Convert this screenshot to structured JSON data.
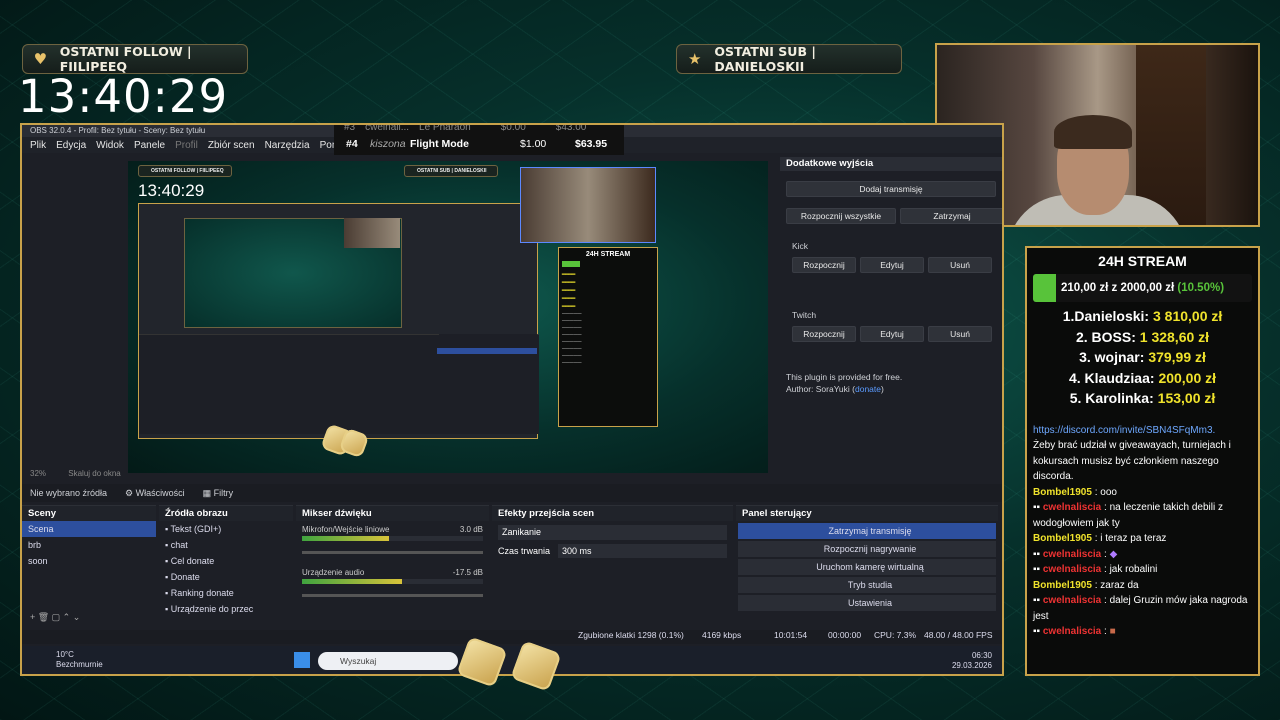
{
  "overlay": {
    "last_follow": "OSTATNI FOLLOW | FIILIPEEQ",
    "last_sub": "OSTATNI SUB | DANIELOSKII",
    "clock": "13:40:29"
  },
  "leaderboard_snippet": {
    "partial_row": {
      "rank": "#3",
      "name": "cwelnali...",
      "title": "Le Pharaon",
      "value": "$0.00",
      "total": "$43.00"
    },
    "row": {
      "rank": "#4",
      "name": "kiszona",
      "title": "Flight Mode",
      "value": "$1.00",
      "total": "$63.95"
    }
  },
  "obs": {
    "window_title": "OBS 32.0.4 - Profil: Bez tytułu - Sceny: Bez tytułu",
    "menu": [
      "Plik",
      "Edycja",
      "Widok",
      "Panele",
      "Profil",
      "Zbiór scen",
      "Narzędzia",
      "Pomoc"
    ],
    "mini": {
      "follow": "OSTATNI FOLLOW | FIILIPEEQ",
      "sub": "OSTATNI SUB | DANIELOSKII",
      "clock": "13:40:29",
      "chat_title": "24H STREAM"
    },
    "zoom": "32%",
    "scale_label": "Skaluj do okna",
    "extra_outputs": {
      "title": "Dodatkowe wyjścia",
      "add_stream": "Dodaj transmisję",
      "start_all": "Rozpocznij wszystkie",
      "stop_all": "Zatrzymaj",
      "services": [
        {
          "name": "Kick",
          "start": "Rozpocznij",
          "edit": "Edytuj",
          "remove": "Usuń"
        },
        {
          "name": "Twitch",
          "start": "Rozpocznij",
          "edit": "Edytuj",
          "remove": "Usuń"
        }
      ],
      "plugin_note": "This plugin is provided for free.",
      "author_prefix": "Author: SoraYuki (",
      "author_link": "donate",
      "author_suffix": ")"
    },
    "source_bar": {
      "no_source": "Nie wybrano źródła",
      "properties": "Właściwości",
      "filters": "Filtry"
    },
    "scenes": {
      "title": "Sceny",
      "items": [
        "Scena",
        "brb",
        "soon"
      ]
    },
    "sources": {
      "title": "Źródła obrazu",
      "items": [
        "Tekst (GDI+)",
        "chat",
        "Cel donate",
        "Donate",
        "Ranking donate",
        "Urządzenie do przec"
      ]
    },
    "mixer": {
      "title": "Mikser dźwięku",
      "channels": [
        {
          "name": "Mikrofon/Wejście liniowe",
          "db": "3.0 dB",
          "level": 0.48
        },
        {
          "name": "Urządzenie audio",
          "db": "-17.5 dB",
          "level": 0.55
        }
      ],
      "scale": [
        "-60",
        "-55",
        "-50",
        "-45",
        "-40",
        "-35",
        "-30",
        "-25",
        "-20",
        "-15",
        "-10",
        "-5",
        "0"
      ]
    },
    "transitions": {
      "title": "Efekty przejścia scen",
      "type": "Zanikanie",
      "duration_label": "Czas trwania",
      "duration": "300 ms"
    },
    "controls": {
      "title": "Panel sterujący",
      "buttons": [
        "Zatrzymaj transmisję",
        "Rozpocznij nagrywanie",
        "Uruchom kamerę wirtualną",
        "Tryb studia",
        "Ustawienia"
      ]
    },
    "status": {
      "dropped": "Zgubione klatki 1298 (0.1%)",
      "bitrate": "4169 kbps",
      "stream_time": "10:01:54",
      "rec_time": "00:00:00",
      "cpu": "CPU: 7.3%",
      "fps": "48.00 / 48.00 FPS"
    },
    "taskbar": {
      "weather_temp": "10°C",
      "weather_desc": "Bezchmurnie",
      "search": "Wyszukaj",
      "time": "06:30",
      "date": "29.03.2026"
    }
  },
  "chat": {
    "title": "24H STREAM",
    "goal": {
      "current": "210,00 zł",
      "joiner": "z",
      "target": "2000,00 zł",
      "percent": "(10.50%)",
      "progress": 0.105
    },
    "ranking": [
      {
        "pos": "1.",
        "name": "Danieloski:",
        "value": "3 810,00 zł"
      },
      {
        "pos": "2.",
        "name": "BOSS:",
        "value": "1 328,60 zł"
      },
      {
        "pos": "3.",
        "name": "wojnar:",
        "value": "379,99 zł"
      },
      {
        "pos": "4.",
        "name": "Klaudziaa:",
        "value": "200,00 zł"
      },
      {
        "pos": "5.",
        "name": "Karolinka:",
        "value": "153,00 zł"
      }
    ],
    "link": "https://discord.com/invite/SBN4SFqMm3.",
    "info": "Żeby brać udział w giveawayach, turniejach i kokursach musisz być członkiem naszego discorda.",
    "messages": [
      {
        "user": "Bombel1905",
        "text": ": ooo",
        "style": "yellow"
      },
      {
        "user": "cwelnaliscia",
        "text": ": na leczenie takich debili z wodogłowiem jak ty",
        "style": "red"
      },
      {
        "user": "Bombel1905",
        "text": ": i teraz pa teraz",
        "style": "yellow"
      },
      {
        "user": "cwelnaliscia",
        "text": ":",
        "style": "red"
      },
      {
        "user": "cwelnaliscia",
        "text": ": jak robalini",
        "style": "red"
      },
      {
        "user": "Bombel1905",
        "text": ": zaraz da",
        "style": "yellow"
      },
      {
        "user": "cwelnaliscia",
        "text": ": dalej Gruzin mów jaka nagroda jest",
        "style": "red"
      },
      {
        "user": "cwelnaliscia",
        "text": ":",
        "style": "red"
      }
    ]
  }
}
